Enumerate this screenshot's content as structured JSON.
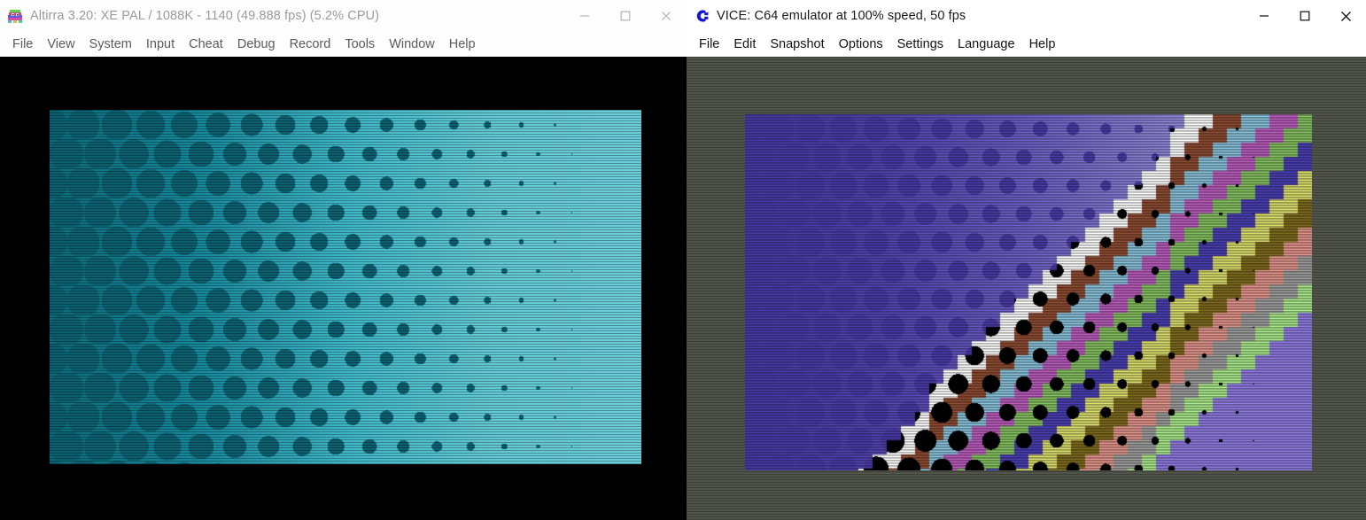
{
  "windows": [
    {
      "id": "altirra",
      "title": "Altirra 3.20: XE PAL / 1088K - 1140 (49.888 fps) (5.2% CPU)",
      "icon": "altirra-logo-icon",
      "active": false,
      "menu": [
        "File",
        "View",
        "System",
        "Input",
        "Cheat",
        "Debug",
        "Record",
        "Tools",
        "Window",
        "Help"
      ],
      "buttons": {
        "minimize": "minimize",
        "maximize": "maximize",
        "close": "close"
      },
      "screen": {
        "name": "atari-emulated-screen",
        "description": "Atari XE halftone dot gradient demo",
        "border_color": "#000000",
        "background_color": "#2db2c4",
        "dot_color": "#0b5f6e",
        "gradient": [
          "#0c6c7c",
          "#17879a",
          "#3fb6c6",
          "#63c9d4",
          "#6ccedb"
        ]
      }
    },
    {
      "id": "vice",
      "title": "VICE: C64 emulator at 100% speed, 50 fps",
      "icon": "commodore-c-icon",
      "active": true,
      "menu": [
        "File",
        "Edit",
        "Snapshot",
        "Options",
        "Settings",
        "Language",
        "Help"
      ],
      "buttons": {
        "minimize": "minimize",
        "maximize": "maximize",
        "close": "close"
      },
      "screen": {
        "name": "c64-emulated-screen",
        "description": "Commodore 64 halftone dot gradient demo with dithered colour bands",
        "border_color": "#4f534a",
        "background_color": "#6a5ac8",
        "dot_color": "#4b3ba8",
        "gradient": [
          "#4b3ba8",
          "#5546b4",
          "#6f62c9",
          "#8f87d7",
          "#9a93dc"
        ],
        "palette": {
          "black": "#000000",
          "white": "#ffffff",
          "brown": "#8c4b32",
          "light_blue": "#87c0d8",
          "purple": "#b85cbb",
          "green": "#85c060",
          "blue": "#4a3fb0",
          "yellow": "#d9dd6c",
          "olive": "#7d6a1e",
          "pink": "#e0948a",
          "grey": "#9c9c9c",
          "light_green": "#a8e88a",
          "light_purple": "#8f7ae0"
        }
      }
    }
  ]
}
